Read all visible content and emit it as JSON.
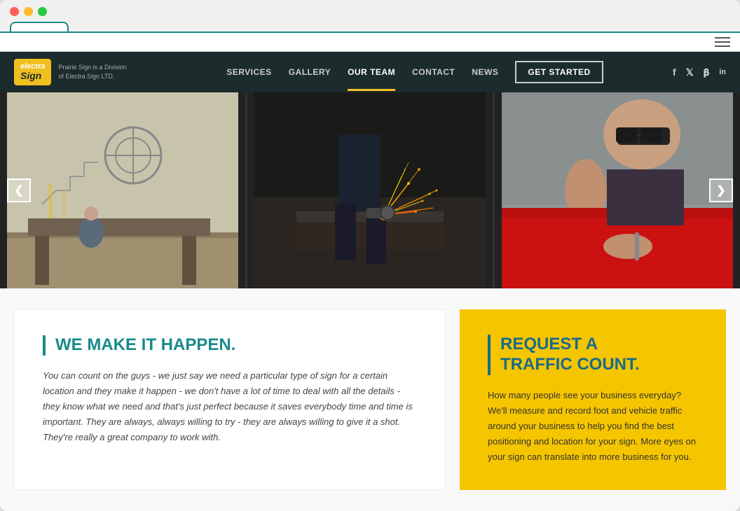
{
  "browser": {
    "tab_label": ""
  },
  "header": {
    "logo": {
      "electra": "electra",
      "sign": "Sign",
      "tagline_line1": "Prairie Sign is a Division",
      "tagline_line2": "of Electra Sign LTD."
    },
    "nav": {
      "items": [
        {
          "label": "SERVICES",
          "active": false
        },
        {
          "label": "GALLERY",
          "active": false
        },
        {
          "label": "OUR TEAM",
          "active": true
        },
        {
          "label": "CONTACT",
          "active": false
        },
        {
          "label": "NEWS",
          "active": false
        }
      ],
      "cta_label": "GET STARTED"
    },
    "social": {
      "facebook": "f",
      "twitter": "t",
      "pinterest": "p",
      "linkedin": "in"
    }
  },
  "carousel": {
    "arrow_left": "❮",
    "arrow_right": "❯"
  },
  "section_left": {
    "title": "WE MAKE IT HAPPEN.",
    "body": "You can count on the guys - we just say we need a particular type of sign for a certain location and they make it happen - we don't have a lot of time to deal with all the details - they know what we need and that's just perfect because it saves everybody time and time is important. They are always, always willing to try - they are always willing to give it a shot. They're really a great company to work with."
  },
  "section_right": {
    "title_line1": "REQUEST A",
    "title_line2": "TRAFFIC COUNT.",
    "body": "How many people see your business everyday? We'll measure and record foot and vehicle traffic around your business to help you find the best positioning and location for your sign. More eyes on your sign can translate into more business for you."
  }
}
